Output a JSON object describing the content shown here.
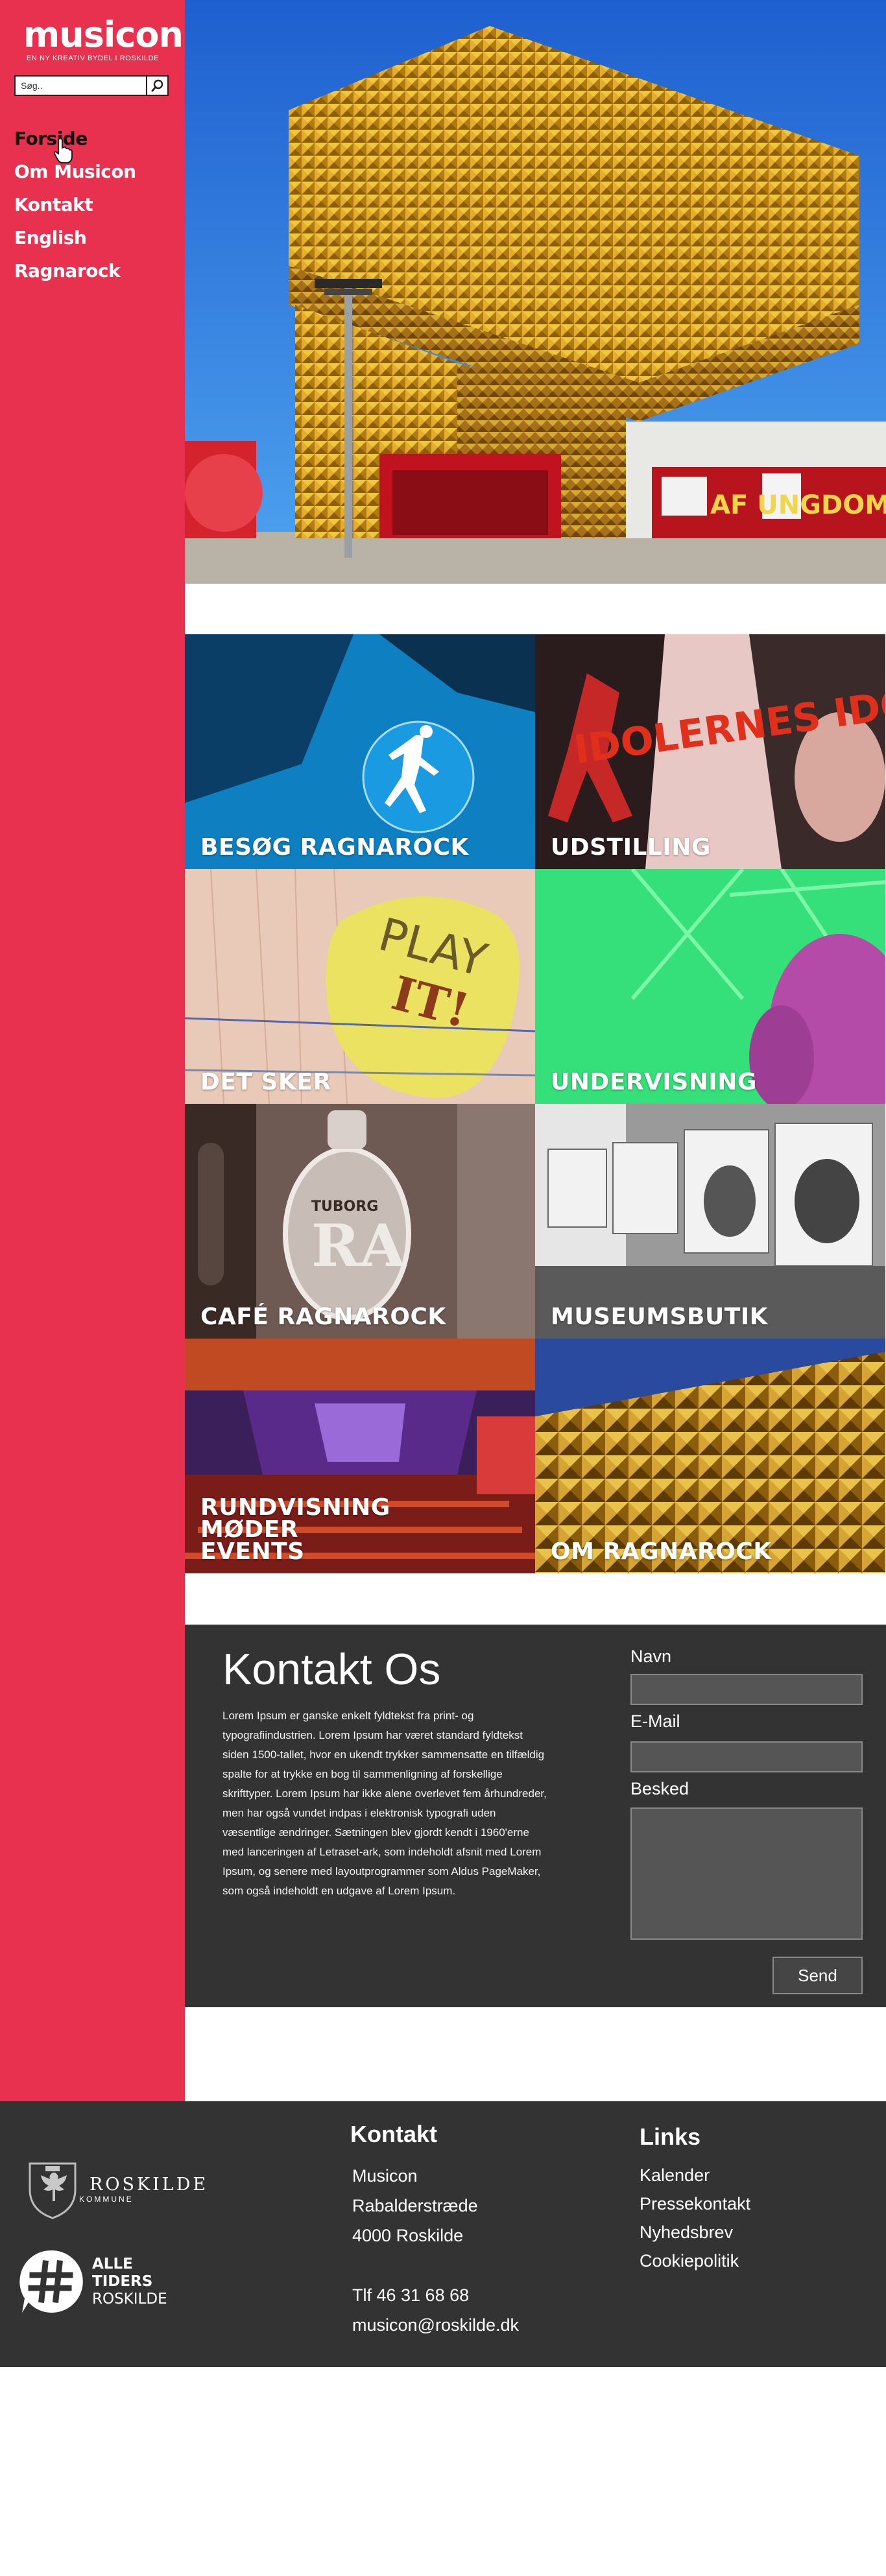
{
  "brand": {
    "logo": "musicon",
    "tagline": "EN NY KREATIV BYDEL I ROSKILDE",
    "accent": "#e8304f",
    "dark": "#333333"
  },
  "search": {
    "placeholder": "Søg..",
    "icon": "search-icon"
  },
  "nav": {
    "items": [
      {
        "label": "Forside",
        "active": true
      },
      {
        "label": "Om Musicon"
      },
      {
        "label": "Kontakt"
      },
      {
        "label": "English"
      },
      {
        "label": "Ragnarock"
      }
    ]
  },
  "hero": {
    "graphic_text": "AF UNGDOM"
  },
  "tiles": [
    {
      "label": "BESØG RAGNAROCK"
    },
    {
      "label": "UDSTILLING",
      "graphic_text": "IDOLERNES IDOLER"
    },
    {
      "label": "DET SKER",
      "graphic_text_1": "PLAY",
      "graphic_text_2": "IT!"
    },
    {
      "label": "UNDERVISNING"
    },
    {
      "label": "CAFÉ RAGNAROCK",
      "graphic_text": "TUBORG"
    },
    {
      "label": "MUSEUMSBUTIK"
    },
    {
      "label": "RUNDVISNING\nMØDER\nEVENTS"
    },
    {
      "label": "OM RAGNAROCK"
    }
  ],
  "contact": {
    "title": "Kontakt Os",
    "body": "Lorem Ipsum er ganske enkelt fyldtekst fra print- og typografiindustrien. Lorem Ipsum har været standard fyldtekst siden 1500-tallet, hvor en ukendt trykker sammensatte en tilfældig spalte for at trykke en bog til sammenligning af forskellige skrifttyper. Lorem Ipsum har ikke alene overlevet fem århundreder, men har også vundet indpas i elektronisk typografi uden væsentlige ændringer. Sætningen blev gjordt kendt i 1960'erne med lanceringen af Letraset-ark, som indeholdt afsnit med Lorem Ipsum, og senere med layoutprogrammer som Aldus PageMaker, som også indeholdt en udgave af Lorem Ipsum.",
    "fields": {
      "name_label": "Navn",
      "email_label": "E-Mail",
      "message_label": "Besked"
    },
    "send_label": "Send"
  },
  "footer": {
    "roskilde": {
      "name": "ROSKILDE",
      "sub": "KOMMUNE"
    },
    "alletiders": {
      "line1": "ALLE",
      "line2": "TIDERS",
      "line3": "ROSKILDE"
    },
    "contact": {
      "title": "Kontakt",
      "lines": [
        "Musicon",
        "Rabalderstræde",
        "4000 Roskilde",
        "",
        "Tlf 46 31 68 68",
        "musicon@roskilde.dk"
      ]
    },
    "links": {
      "title": "Links",
      "items": [
        "Kalender",
        "Pressekontakt",
        "Nyhedsbrev",
        "Cookiepolitik"
      ]
    }
  }
}
